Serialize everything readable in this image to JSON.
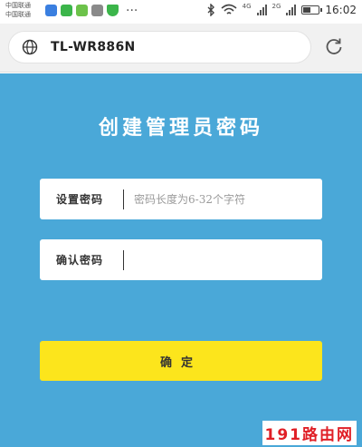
{
  "status_bar": {
    "carrier_1": "中国联通",
    "carrier_2": "中国联通",
    "net_4g": "4G",
    "net_2g": "2G",
    "more": "···",
    "battery_level": 0.5,
    "time": "16:02"
  },
  "browser": {
    "url": "TL-WR886N"
  },
  "page": {
    "title": "创建管理员密码",
    "set_password_label": "设置密码",
    "set_password_placeholder": "密码长度为6-32个字符",
    "confirm_password_label": "确认密码",
    "confirm_password_value": "",
    "confirm_button_label": "确定"
  },
  "watermark": "191路由网",
  "colors": {
    "page_background": "#4aa8d8",
    "button": "#fce51c",
    "watermark": "#e01f26"
  }
}
